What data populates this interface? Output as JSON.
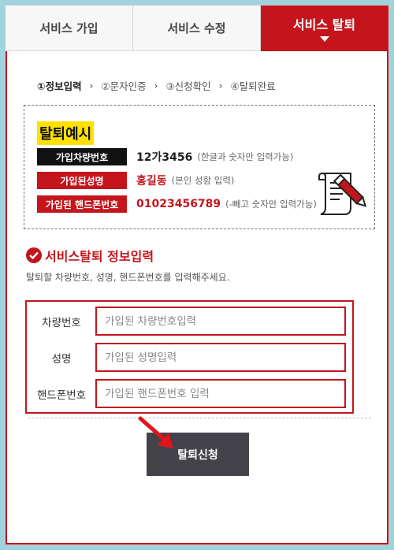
{
  "tabs": [
    {
      "label": "서비스 가입"
    },
    {
      "label": "서비스 수정"
    },
    {
      "label": "서비스 탈퇴"
    }
  ],
  "steps": [
    {
      "label": "①정보입력"
    },
    {
      "label": "②문자인증"
    },
    {
      "label": "③신청확인"
    },
    {
      "label": "④탈퇴완료"
    }
  ],
  "step_arrow": "›",
  "example": {
    "title": "탈퇴예시",
    "rows": [
      {
        "label": "가입차량번호",
        "value": "12가3456",
        "note": "(한글과 숫자만 입력가능)"
      },
      {
        "label": "가입된성명",
        "value": "홍길동",
        "note": "(본인 성함 입력)"
      },
      {
        "label": "가입된 핸드폰번호",
        "value": "01023456789",
        "note": "(-빼고 숫자만 입력가능)"
      }
    ]
  },
  "section": {
    "title": "서비스탈퇴 정보입력",
    "description": "탈퇴할 차량번호, 성명, 핸드폰번호를 입력해주세요."
  },
  "form": {
    "fields": [
      {
        "label": "차량번호",
        "placeholder": "가입된 차량번호입력"
      },
      {
        "label": "성명",
        "placeholder": "가입된 성명입력"
      },
      {
        "label": "핸드폰번호",
        "placeholder": "가입된 핸드폰번호 입력"
      }
    ]
  },
  "submit_label": "탈퇴신청",
  "colors": {
    "accent": "#c4151c",
    "highlight": "#ffe100",
    "button": "#434349",
    "background": "#9fd3dd"
  },
  "icons": [
    "caret-down-icon",
    "check-circle-icon",
    "document-pen-icon",
    "red-arrow-pointer-icon"
  ]
}
